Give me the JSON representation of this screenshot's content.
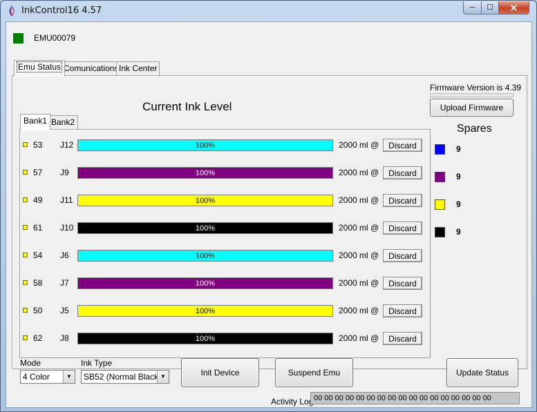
{
  "window": {
    "title": "InkControl16  4.57",
    "close_glyph": "✕",
    "min_glyph": "─",
    "max_glyph": "☐"
  },
  "device": {
    "status_color": "#008000",
    "id": "EMU00079"
  },
  "tabs": [
    {
      "label": "Emu Status",
      "active": true
    },
    {
      "label": "Comunications",
      "active": false
    },
    {
      "label": "Ink Center",
      "active": false
    }
  ],
  "firmware": {
    "version_text": "Firmware Version is 4.39",
    "upload_label": "Upload Firmware"
  },
  "ink": {
    "title": "Current Ink Level",
    "bank_tabs": [
      {
        "label": "Bank1",
        "active": true
      },
      {
        "label": "Bank2",
        "active": false
      }
    ],
    "rows": [
      {
        "count": "53",
        "slot": "J12",
        "color": "#00ffff",
        "text_color": "#000000",
        "level": "100%",
        "volume": "2000 ml @",
        "discard": "Discard"
      },
      {
        "count": "57",
        "slot": "J9",
        "color": "#800080",
        "text_color": "#ffffff",
        "level": "100%",
        "volume": "2000 ml @",
        "discard": "Discard"
      },
      {
        "count": "49",
        "slot": "J11",
        "color": "#ffff00",
        "text_color": "#000000",
        "level": "100%",
        "volume": "2000 ml @",
        "discard": "Discard"
      },
      {
        "count": "61",
        "slot": "J10",
        "color": "#000000",
        "text_color": "#ffffff",
        "level": "100%",
        "volume": "2000 ml @",
        "discard": "Discard"
      },
      {
        "count": "54",
        "slot": "J6",
        "color": "#00ffff",
        "text_color": "#000000",
        "level": "100%",
        "volume": "2000 ml @",
        "discard": "Discard"
      },
      {
        "count": "58",
        "slot": "J7",
        "color": "#800080",
        "text_color": "#ffffff",
        "level": "100%",
        "volume": "2000 ml @",
        "discard": "Discard"
      },
      {
        "count": "50",
        "slot": "J5",
        "color": "#ffff00",
        "text_color": "#000000",
        "level": "100%",
        "volume": "2000 ml @",
        "discard": "Discard"
      },
      {
        "count": "62",
        "slot": "J8",
        "color": "#000000",
        "text_color": "#ffffff",
        "level": "100%",
        "volume": "2000 ml @",
        "discard": "Discard"
      }
    ]
  },
  "spares": {
    "title": "Spares",
    "items": [
      {
        "color": "#0000ff",
        "count": "9"
      },
      {
        "color": "#800080",
        "count": "9"
      },
      {
        "color": "#ffff00",
        "count": "9"
      },
      {
        "color": "#000000",
        "count": "9"
      }
    ]
  },
  "controls": {
    "mode_label": "Mode",
    "mode_value": "4 Color",
    "ink_type_label": "Ink Type",
    "ink_type_value": "SB52 (Normal Black)",
    "init_label": "Init Device",
    "suspend_label": "Suspend Emu",
    "update_label": "Update Status"
  },
  "activity": {
    "label": "Activity Log",
    "value": "00 00 00 00 00 00 00 00 00 00 00 00 00 00 00 00 00"
  }
}
